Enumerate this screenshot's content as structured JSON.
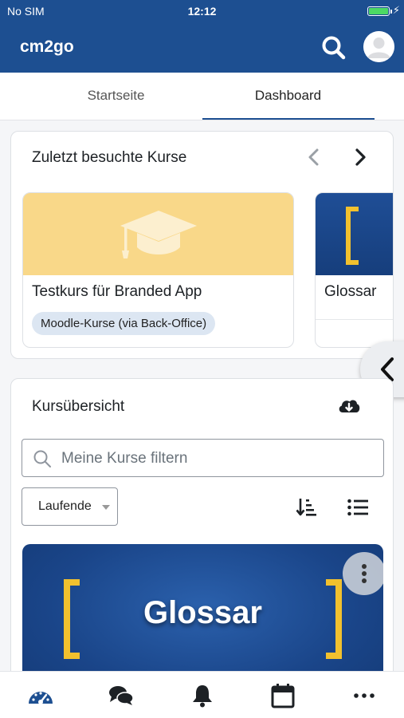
{
  "status_bar": {
    "carrier": "No SIM",
    "time": "12:12",
    "battery_level": 1.0,
    "battery_color": "#4cd964"
  },
  "app_bar": {
    "title": "cm2go",
    "background": "#1d4f91"
  },
  "tabs": [
    {
      "label": "Startseite",
      "active": false
    },
    {
      "label": "Dashboard",
      "active": true
    }
  ],
  "recent_courses": {
    "heading": "Zuletzt besuchte Kurse",
    "courses": [
      {
        "name": "Testkurs für Branded App",
        "category": "Moodle-Kurse (via Back-Office)",
        "image_icon": "graduation-cap-icon",
        "image_color": "#f9d889"
      },
      {
        "name": "Glossar",
        "image_icon": "bracket-icon"
      }
    ]
  },
  "course_overview": {
    "heading": "Kursübersicht",
    "filter": {
      "placeholder": "Meine Kurse filtern",
      "value": ""
    },
    "status_select": {
      "selected": "Laufende"
    },
    "course_card": {
      "title": "Glossar"
    }
  },
  "bottom_tabs": [
    {
      "icon": "dashboard-gauge-icon"
    },
    {
      "icon": "chat-bubbles-icon"
    },
    {
      "icon": "bell-icon"
    },
    {
      "icon": "calendar-icon"
    },
    {
      "icon": "more-icon"
    }
  ]
}
